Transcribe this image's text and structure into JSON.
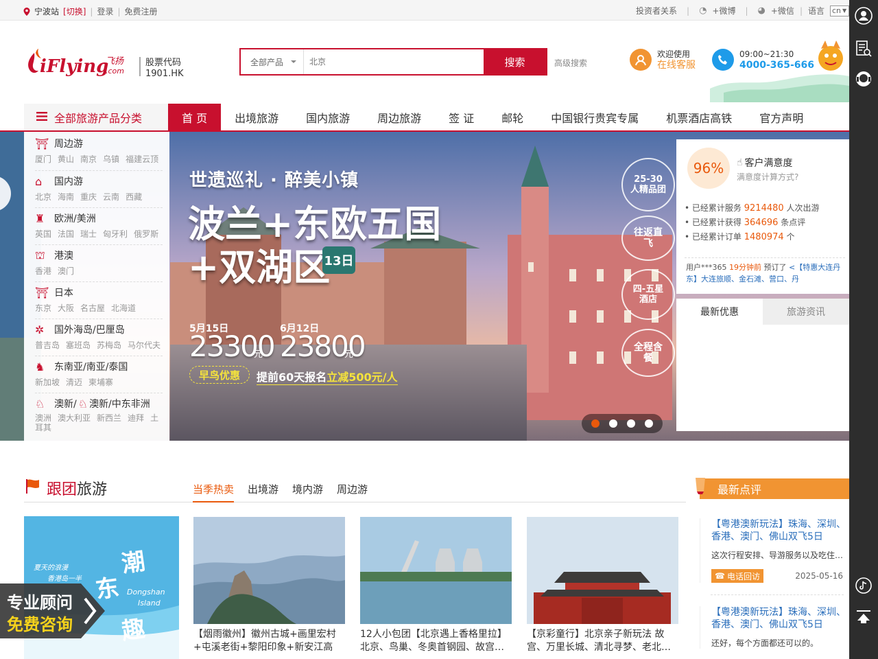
{
  "topbar": {
    "city": "宁波站",
    "switch": "[切换]",
    "login": "登录",
    "register": "免费注册",
    "investor": "投资者关系",
    "weibo": "+微博",
    "weixin": "+微信",
    "language": "语言",
    "lang_value": "cn"
  },
  "header": {
    "logo_text": "iFlying.com",
    "logo_cn": "飞扬",
    "stock_label": "股票代码",
    "stock_code": "1901.HK",
    "search_category": "全部产品",
    "search_placeholder": "北京",
    "search_button": "搜索",
    "advanced_search": "高级搜索",
    "welcome": "欢迎使用",
    "online_service": "在线客服",
    "hours": "09:00~21:30",
    "phone": "4000-365-666"
  },
  "nav": {
    "all_label": "全部旅游产品分类",
    "items": [
      "首 页",
      "出境旅游",
      "国内旅游",
      "周边旅游",
      "签 证",
      "邮轮",
      "中国银行贵宾专属",
      "机票酒店高铁",
      "官方声明"
    ]
  },
  "side_menu": [
    {
      "title": "周边游",
      "icon": "gate-icon",
      "subs": [
        "厦门",
        "黄山",
        "南京",
        "乌镇",
        "福建云顶"
      ]
    },
    {
      "title": "国内游",
      "icon": "temple-icon",
      "subs": [
        "北京",
        "海南",
        "重庆",
        "云南",
        "西藏"
      ]
    },
    {
      "title": "欧洲/美洲",
      "icon": "statue-icon",
      "subs": [
        "英国",
        "法国",
        "瑞士",
        "匈牙利",
        "俄罗斯"
      ]
    },
    {
      "title": "港澳",
      "icon": "pagoda-icon",
      "subs": [
        "香港",
        "澳门"
      ]
    },
    {
      "title": "日本",
      "icon": "torii-icon",
      "subs": [
        "东京",
        "大阪",
        "名古屋",
        "北海道"
      ]
    },
    {
      "title": "国外海岛/巴厘岛",
      "icon": "palm-icon",
      "subs": [
        "普吉岛",
        "塞班岛",
        "苏梅岛",
        "马尔代夫"
      ]
    },
    {
      "title": "东南亚/南亚/泰国",
      "icon": "elephant-icon",
      "subs": [
        "新加坡",
        "清迈",
        "柬埔寨"
      ]
    },
    {
      "title": "澳新/",
      "title2": "澳新/中东非洲",
      "icon": "kangaroo-icon",
      "subs": [
        "澳洲",
        "澳大利亚",
        "新西兰",
        "迪拜",
        "土耳其"
      ]
    }
  ],
  "banner": {
    "tagline": "世遗巡礼 · 醉美小镇",
    "title1": "波兰+东欧五国",
    "title2": "+双湖区",
    "days": "13日",
    "date1": "5月15日",
    "price1": "23300",
    "date2": "6月12日",
    "price2": "23800",
    "yuan": "元",
    "early": "早鸟优惠",
    "promo_pre": "提前60天报名",
    "promo_hl": "立减500元/人",
    "badges": [
      "25-30人精品团",
      "往返直飞",
      "四-五星酒店",
      "全程含餐"
    ],
    "dots": 4,
    "active_dot": 0
  },
  "stats": {
    "rate": "96%",
    "satisfaction": "客户满意度",
    "method": "满意度计算方式?",
    "lines": [
      {
        "pre": "已经累计服务",
        "num": "9214480",
        "post": "人次出游"
      },
      {
        "pre": "已经累计获得",
        "num": "364696",
        "post": "条点评"
      },
      {
        "pre": "已经累计订单",
        "num": "1480974",
        "post": "个"
      }
    ],
    "recent_user": "用户***365",
    "recent_time": "19分钟前",
    "recent_action": "预订了",
    "recent_product": "<【特惠大连丹东】大连旅顺、金石滩、营口、丹"
  },
  "info_tabs": [
    "最新优惠",
    "旅游资讯"
  ],
  "section": {
    "title_red": "跟团",
    "title_rest": "旅游",
    "tabs": [
      "当季热卖",
      "出境游",
      "境内游",
      "周边游"
    ],
    "promo_img_text": [
      "夏天的浪漫",
      "香港岛一半",
      "潮",
      "东",
      "趣",
      "Dongshan",
      "Island"
    ],
    "cards": [
      {
        "caption": "【烟雨徽州】徽州古城+画里宏村+屯溪老街+黎阳印象+新安江高铁…"
      },
      {
        "caption": "12人小包团【北京遇上香格里拉】北京、鸟巢、冬奥首钢园、故宫…"
      },
      {
        "caption": "【京彩童行】北京亲子新玩法 故宫、万里长城、清北寻梦、老北…"
      }
    ]
  },
  "reviews": {
    "title": "最新点评",
    "items": [
      {
        "title": "【粤港澳新玩法】珠海、深圳、香港、澳门、佛山双飞5日",
        "desc": "这次行程安排、导游服务以及吃住…",
        "callback": "电话回访",
        "date": "2025-05-16"
      },
      {
        "title": "【粤港澳新玩法】珠海、深圳、香港、澳门、佛山双飞5日",
        "desc": "还好，每个方面都还可以的。"
      }
    ]
  },
  "consult": {
    "line1": "专业顾问",
    "line2": "免费咨询"
  },
  "colors": {
    "brand": "#c8102e",
    "orange": "#f19432",
    "link": "#2a6ebb"
  }
}
